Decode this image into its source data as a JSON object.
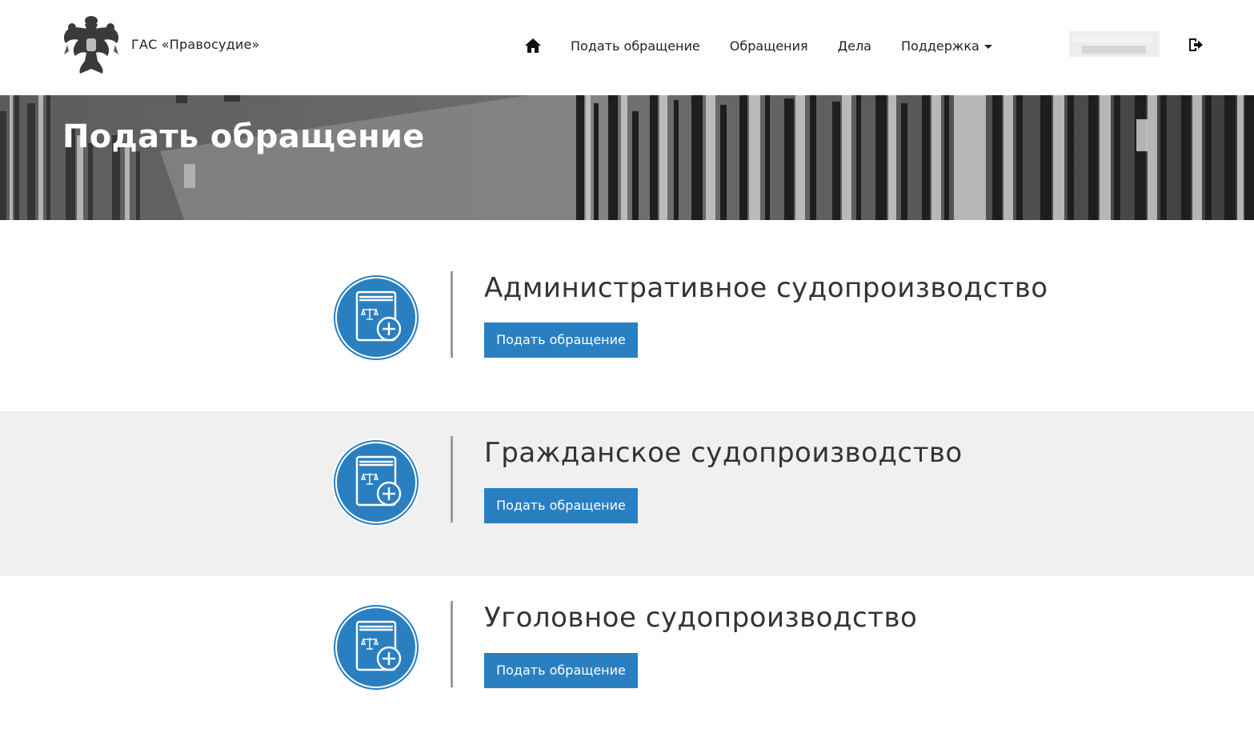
{
  "header": {
    "brand_title": "ГАС «Правосудие»",
    "nav": {
      "submit": "Подать обращение",
      "appeals": "Обращения",
      "cases": "Дела",
      "support": "Поддержка"
    },
    "user_name": ""
  },
  "banner": {
    "title": "Подать обращение"
  },
  "sections": [
    {
      "title": "Административное судопроизводство",
      "button": "Подать обращение"
    },
    {
      "title": "Гражданское судопроизводство",
      "button": "Подать обращение"
    },
    {
      "title": "Уголовное судопроизводство",
      "button": "Подать обращение"
    }
  ],
  "colors": {
    "accent": "#2a7fc1",
    "alt_section_bg": "#f0f0f0"
  },
  "icons": {
    "emblem": "coat-of-arms",
    "home": "home-icon",
    "logout": "logout-icon",
    "section": "book-plus-icon"
  }
}
